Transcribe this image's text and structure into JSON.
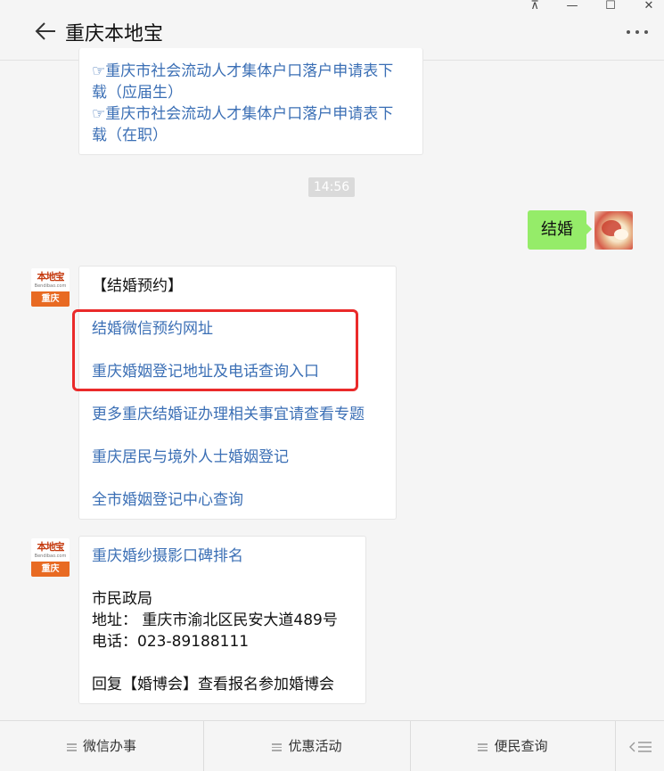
{
  "window": {
    "title": "重庆本地宝",
    "pin_glyph": "⊼",
    "minimize_glyph": "—",
    "maximize_glyph": "☐",
    "close_glyph": "✕"
  },
  "messages": {
    "top_links": [
      "☞重庆市社会流动人才集体户口落户申请表下",
      "载（应届生）",
      "☞重庆市社会流动人才集体户口落户申请表下",
      "载（在职）"
    ],
    "timestamp": "14:56",
    "sent_text": "结婚",
    "avatar": {
      "brand": "本地宝",
      "domain": "Bendibao.com",
      "city": "重庆"
    },
    "reply1": {
      "heading": "【结婚预约】",
      "links": [
        "结婚微信预约网址",
        "重庆婚姻登记地址及电话查询入口",
        "更多重庆结婚证办理相关事宜请查看专题",
        "重庆居民与境外人士婚姻登记",
        "全市婚姻登记中心查询"
      ]
    },
    "reply2": {
      "link": "重庆婚纱摄影口碑排名",
      "org": "市民政局",
      "address": "地址：  重庆市渝北区民安大道489号",
      "phone": "电话：023-89188111",
      "footer": "回复【婚博会】查看报名参加婚博会"
    }
  },
  "bottom_menu": [
    "微信办事",
    "优惠活动",
    "便民查询"
  ],
  "colors": {
    "link": "#3b6fb5",
    "sent_bubble": "#95ec69",
    "highlight": "#ea2a2a",
    "brand": "#e86a22"
  }
}
